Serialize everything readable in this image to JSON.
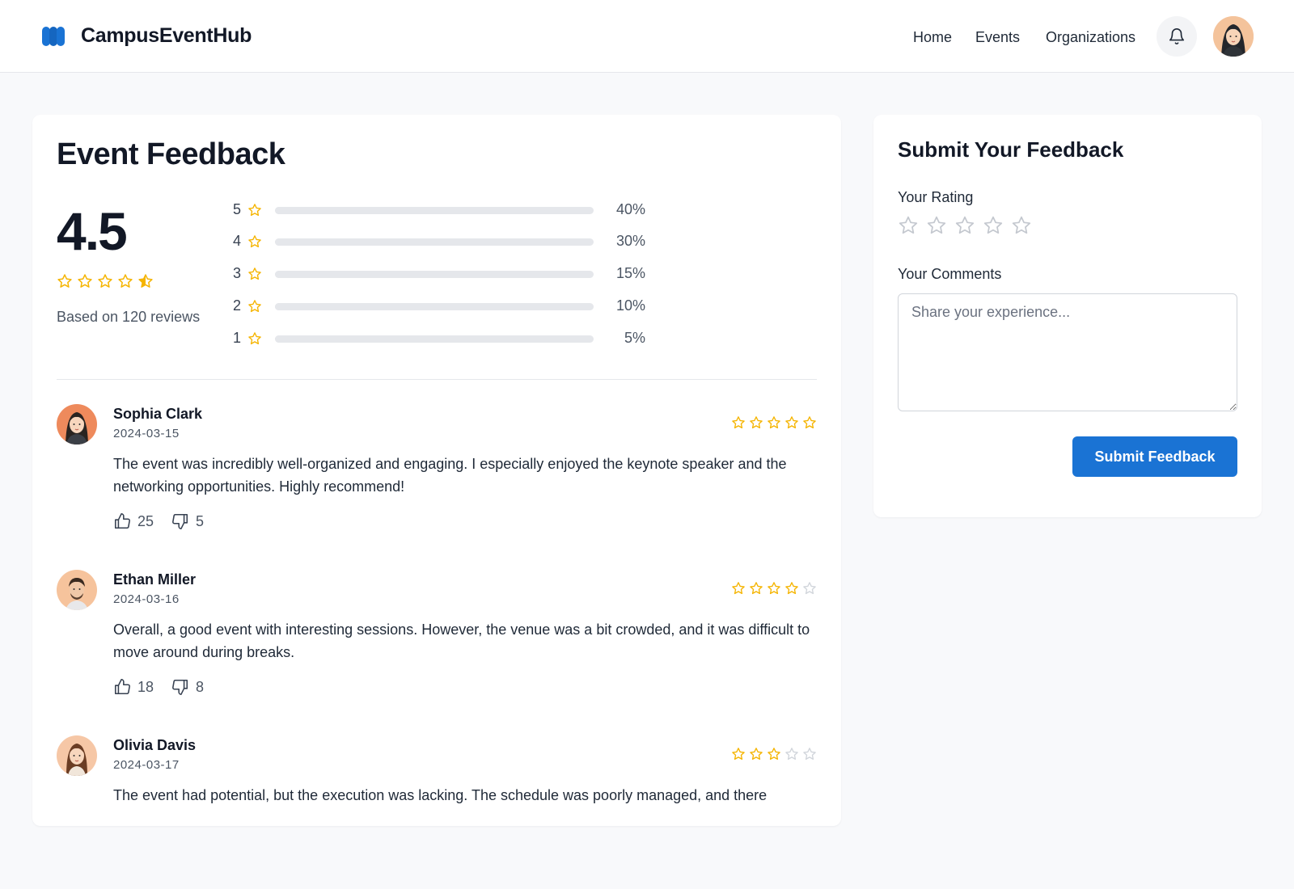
{
  "app": {
    "name": "CampusEventHub",
    "brand_color": "#1a73d4",
    "logo_icon": "campus-logo-icon"
  },
  "nav": {
    "items": [
      {
        "label": "Home"
      },
      {
        "label": "Events"
      },
      {
        "label": "Organizations"
      }
    ],
    "notification_icon": "bell-icon",
    "profile_avatar": "user-avatar"
  },
  "summary": {
    "title": "Event Feedback",
    "average": "4.5",
    "average_stars": 4.5,
    "based_on": "Based on 120 reviews",
    "star_color": "#f5b400",
    "distribution": [
      {
        "stars": "5",
        "percent": "40%",
        "fraction": 0.4
      },
      {
        "stars": "4",
        "percent": "30%",
        "fraction": 0.3
      },
      {
        "stars": "3",
        "percent": "15%",
        "fraction": 0.15
      },
      {
        "stars": "2",
        "percent": "10%",
        "fraction": 0.1
      },
      {
        "stars": "1",
        "percent": "5%",
        "fraction": 0.05
      }
    ]
  },
  "reviews": [
    {
      "name": "Sophia Clark",
      "date": "2024-03-15",
      "rating": 5,
      "text": "The event was incredibly well-organized and engaging. I especially enjoyed the keynote speaker and the networking opportunities. Highly recommend!",
      "likes": "25",
      "dislikes": "5"
    },
    {
      "name": "Ethan Miller",
      "date": "2024-03-16",
      "rating": 4,
      "text": "Overall, a good event with interesting sessions. However, the venue was a bit crowded, and it was difficult to move around during breaks.",
      "likes": "18",
      "dislikes": "8"
    },
    {
      "name": "Olivia Davis",
      "date": "2024-03-17",
      "rating": 3,
      "text": "The event had potential, but the execution was lacking. The schedule was poorly managed, and there",
      "likes": "",
      "dislikes": ""
    }
  ],
  "form": {
    "title": "Submit Your Feedback",
    "rating_label": "Your Rating",
    "rating_value": 0,
    "comments_label": "Your Comments",
    "comments_placeholder": "Share your experience...",
    "comments_value": "",
    "submit_label": "Submit Feedback"
  }
}
